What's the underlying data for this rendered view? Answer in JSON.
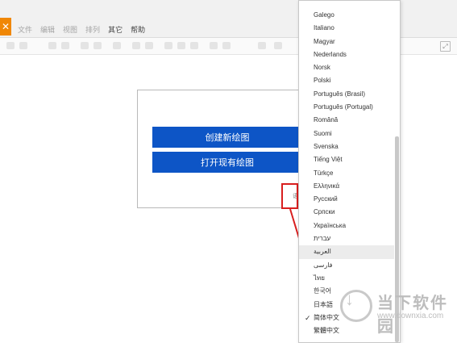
{
  "app": {
    "logo_glyph": "✕",
    "menus": [
      "文件",
      "编辑",
      "视图",
      "排列",
      "其它",
      "帮助"
    ],
    "toolbar_right_icon": "⤢"
  },
  "dialog": {
    "create_label": "创建新绘图",
    "open_label": "打开现有绘图",
    "language_link": "语言"
  },
  "language_menu": {
    "items": [
      {
        "label": "Galego",
        "selected": false
      },
      {
        "label": "Italiano",
        "selected": false
      },
      {
        "label": "Magyar",
        "selected": false
      },
      {
        "label": "Nederlands",
        "selected": false
      },
      {
        "label": "Norsk",
        "selected": false
      },
      {
        "label": "Polski",
        "selected": false
      },
      {
        "label": "Português (Brasil)",
        "selected": false
      },
      {
        "label": "Português (Portugal)",
        "selected": false
      },
      {
        "label": "Română",
        "selected": false
      },
      {
        "label": "Suomi",
        "selected": false
      },
      {
        "label": "Svenska",
        "selected": false
      },
      {
        "label": "Tiếng Việt",
        "selected": false
      },
      {
        "label": "Türkçe",
        "selected": false
      },
      {
        "label": "Ελληνικά",
        "selected": false
      },
      {
        "label": "Русский",
        "selected": false
      },
      {
        "label": "Српски",
        "selected": false
      },
      {
        "label": "Українська",
        "selected": false
      },
      {
        "label": "עברית",
        "selected": false
      },
      {
        "label": "العربية",
        "selected": false,
        "hover": true
      },
      {
        "label": "فارسی",
        "selected": false
      },
      {
        "label": "ไทย",
        "selected": false
      },
      {
        "label": "한국어",
        "selected": false
      },
      {
        "label": "日本語",
        "selected": false
      },
      {
        "label": "简体中文",
        "selected": true
      },
      {
        "label": "繁體中文",
        "selected": false
      }
    ],
    "check_glyph": "✓"
  },
  "watermark": {
    "title": "当下软件园",
    "url": "www.downxia.com"
  },
  "colors": {
    "button_blue": "#0d55c6",
    "annotation_red": "#d81e1e",
    "logo_orange": "#f08705"
  }
}
